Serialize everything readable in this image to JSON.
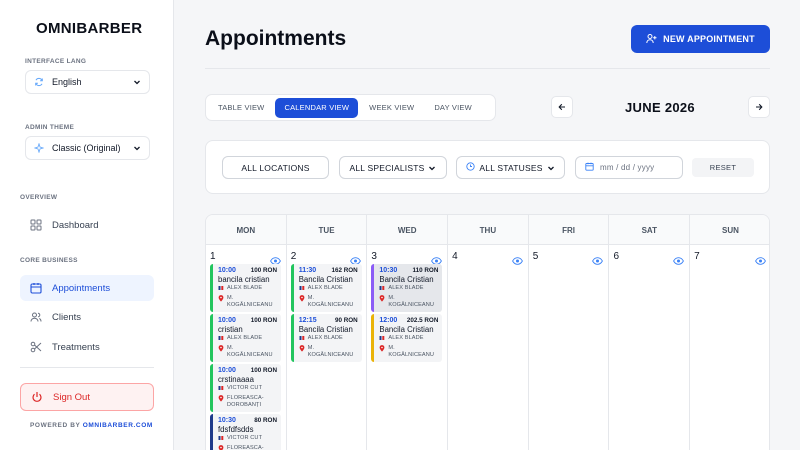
{
  "brand": "OMNIBARBER",
  "sidebar": {
    "interface_lang_label": "INTERFACE LANG",
    "interface_lang_value": "English",
    "admin_theme_label": "ADMIN THEME",
    "admin_theme_value": "Classic (Original)",
    "overview_label": "OVERVIEW",
    "dashboard": "Dashboard",
    "core_business_label": "CORE BUSINESS",
    "appointments": "Appointments",
    "clients": "Clients",
    "treatments": "Treatments",
    "sign_out": "Sign Out",
    "powered_prefix": "POWERED BY",
    "powered_link": "OMNIBARBER.COM"
  },
  "header": {
    "title": "Appointments",
    "new_button": "NEW APPOINTMENT"
  },
  "views": {
    "table": "TABLE VIEW",
    "calendar": "CALENDAR VIEW",
    "week": "WEEK VIEW",
    "day": "DAY VIEW",
    "active": "calendar"
  },
  "month": "JUNE 2026",
  "filters": {
    "locations": "ALL LOCATIONS",
    "specialists": "ALL SPECIALISTS",
    "statuses": "ALL STATUSES",
    "date_placeholder": "mm / dd / yyyy",
    "reset": "RESET"
  },
  "calendar": {
    "weekdays": [
      "MON",
      "TUE",
      "WED",
      "THU",
      "FRI",
      "SAT",
      "SUN"
    ],
    "days": [
      {
        "num": "1",
        "appointments": [
          {
            "time": "10:00",
            "price": "100 RON",
            "name": "bancila cristian",
            "specialist": "ALEX BLADE",
            "location": "M. KOGĂLNICEANU",
            "color": "#22c55e"
          },
          {
            "time": "10:00",
            "price": "100 RON",
            "name": "cristian",
            "specialist": "ALEX BLADE",
            "location": "M. KOGĂLNICEANU",
            "color": "#22c55e"
          },
          {
            "time": "10:00",
            "price": "100 RON",
            "name": "crstinaaaa",
            "specialist": "VICTOR CUT",
            "location": "FLOREASCA-DOROBANȚI",
            "color": "#22c55e"
          },
          {
            "time": "10:30",
            "price": "80 RON",
            "name": "fdsfdfsdds",
            "specialist": "VICTOR CUT",
            "location": "FLOREASCA-",
            "color": "#1e3a8a"
          }
        ]
      },
      {
        "num": "2",
        "appointments": [
          {
            "time": "11:30",
            "price": "162 RON",
            "name": "Bancila Cristian",
            "specialist": "ALEX BLADE",
            "location": "M. KOGĂLNICEANU",
            "color": "#22c55e"
          },
          {
            "time": "12:15",
            "price": "90 RON",
            "name": "Bancila Cristian",
            "specialist": "ALEX BLADE",
            "location": "M. KOGĂLNICEANU",
            "color": "#22c55e"
          }
        ]
      },
      {
        "num": "3",
        "appointments": [
          {
            "time": "10:30",
            "price": "110 RON",
            "name": "Bancila Cristian",
            "specialist": "ALEX BLADE",
            "location": "M. KOGĂLNICEANU",
            "color": "#8b5cf6"
          },
          {
            "time": "12:00",
            "price": "202.5 RON",
            "name": "Bancila Cristian",
            "specialist": "ALEX BLADE",
            "location": "M. KOGĂLNICEANU",
            "color": "#eab308"
          }
        ]
      },
      {
        "num": "4",
        "appointments": []
      },
      {
        "num": "5",
        "appointments": []
      },
      {
        "num": "6",
        "appointments": []
      },
      {
        "num": "7",
        "appointments": []
      }
    ]
  }
}
